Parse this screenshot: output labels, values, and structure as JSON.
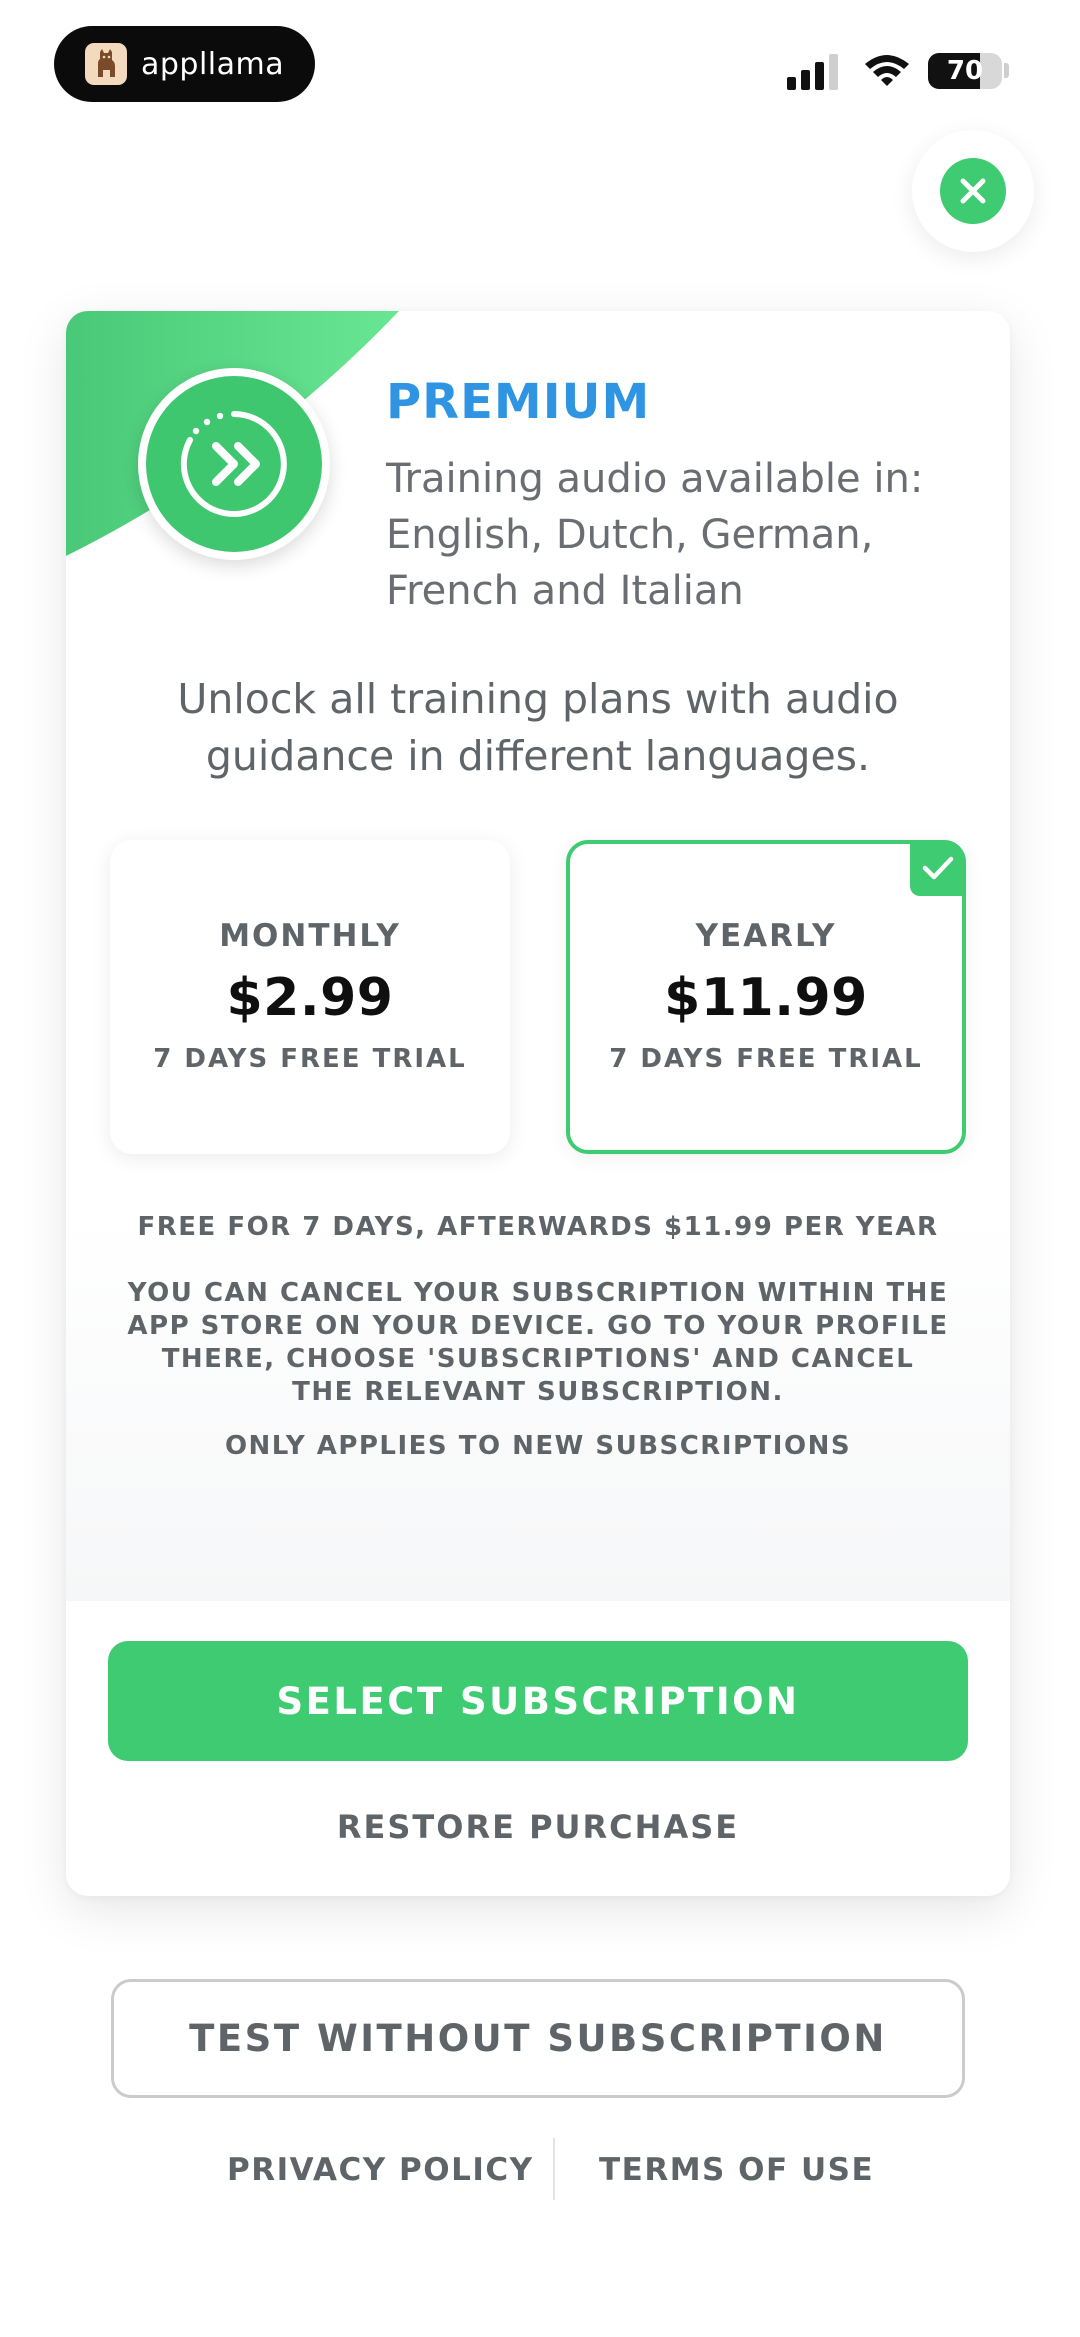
{
  "status_bar": {
    "brand": "appllama",
    "battery": "70"
  },
  "header": {
    "close_icon": "close-icon"
  },
  "card": {
    "badge_icon": "fast-forward-icon",
    "title": "PREMIUM",
    "languages_text": "Training audio available in: English, Dutch, German, French and Italian",
    "unlock_text": "Unlock all training plans with audio guidance in different languages.",
    "plans": [
      {
        "name": "MONTHLY",
        "price": "$2.99",
        "trial": "7 DAYS FREE TRIAL",
        "selected": false
      },
      {
        "name": "YEARLY",
        "price": "$11.99",
        "trial": "7 DAYS FREE TRIAL",
        "selected": true
      }
    ],
    "fine_print_1": "FREE FOR 7 DAYS, AFTERWARDS $11.99 PER YEAR",
    "fine_print_2": "YOU CAN CANCEL YOUR SUBSCRIPTION WITHIN THE APP STORE ON YOUR DEVICE. GO TO YOUR PROFILE THERE, CHOOSE 'SUBSCRIPTIONS' AND CANCEL THE RELEVANT SUBSCRIPTION.",
    "fine_print_3": "ONLY APPLIES TO NEW SUBSCRIPTIONS",
    "select_label": "SELECT SUBSCRIPTION",
    "restore_label": "RESTORE PURCHASE"
  },
  "test_label": "TEST WITHOUT SUBSCRIPTION",
  "footer": {
    "privacy": "PRIVACY POLICY",
    "terms": "TERMS OF USE"
  },
  "colors": {
    "accent_green": "#3ecb72",
    "title_blue": "#2f95e3",
    "text_gray": "#5f6468"
  }
}
